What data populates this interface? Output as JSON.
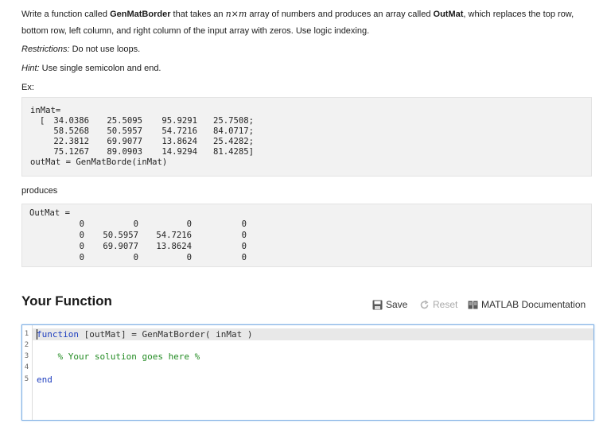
{
  "problem": {
    "line1_pre": "Write a function called ",
    "func_name": "GenMatBorder",
    "line1_mid": " that takes an ",
    "math": "n×m",
    "line1_mid2": " array of numbers and produces an array called ",
    "out_name": "OutMat",
    "line1_post": ", which replaces the top row,",
    "line2": "bottom row, left column, and right column of the input array with zeros. Use logic indexing.",
    "restrictions_label": "Restrictions:",
    "restrictions_text": " Do not use loops.",
    "hint_label": "Hint:",
    "hint_text": " Use single semicolon and end.",
    "ex_label": "Ex:",
    "produces": "produces"
  },
  "example_input": {
    "label": "inMat=",
    "bracket_open": "[",
    "bracket_close": "]",
    "rows": [
      [
        "34.0386",
        "25.5095",
        "95.9291",
        "25.7508;"
      ],
      [
        "58.5268",
        "50.5957",
        "54.7216",
        "84.0717;"
      ],
      [
        "22.3812",
        "69.9077",
        "13.8624",
        "25.4282;"
      ],
      [
        "75.1267",
        "89.0903",
        "14.9294",
        "81.4285"
      ]
    ],
    "call": "outMat = GenMatBorde(inMat)"
  },
  "example_output": {
    "label": "OutMat =",
    "rows": [
      [
        "0",
        "0",
        "0",
        "0"
      ],
      [
        "0",
        "50.5957",
        "54.7216",
        "0"
      ],
      [
        "0",
        "69.9077",
        "13.8624",
        "0"
      ],
      [
        "0",
        "0",
        "0",
        "0"
      ]
    ]
  },
  "section": {
    "title": "Your Function"
  },
  "toolbar": {
    "save": "Save",
    "reset": "Reset",
    "docs": "MATLAB Documentation"
  },
  "editor": {
    "line_numbers": [
      "1",
      "2",
      "3",
      "4",
      "5"
    ],
    "line1_kw": "function",
    "line1_rest": " [outMat] = GenMatBorder( inMat )",
    "line3": "    % Your solution goes here %",
    "line5": "end"
  }
}
